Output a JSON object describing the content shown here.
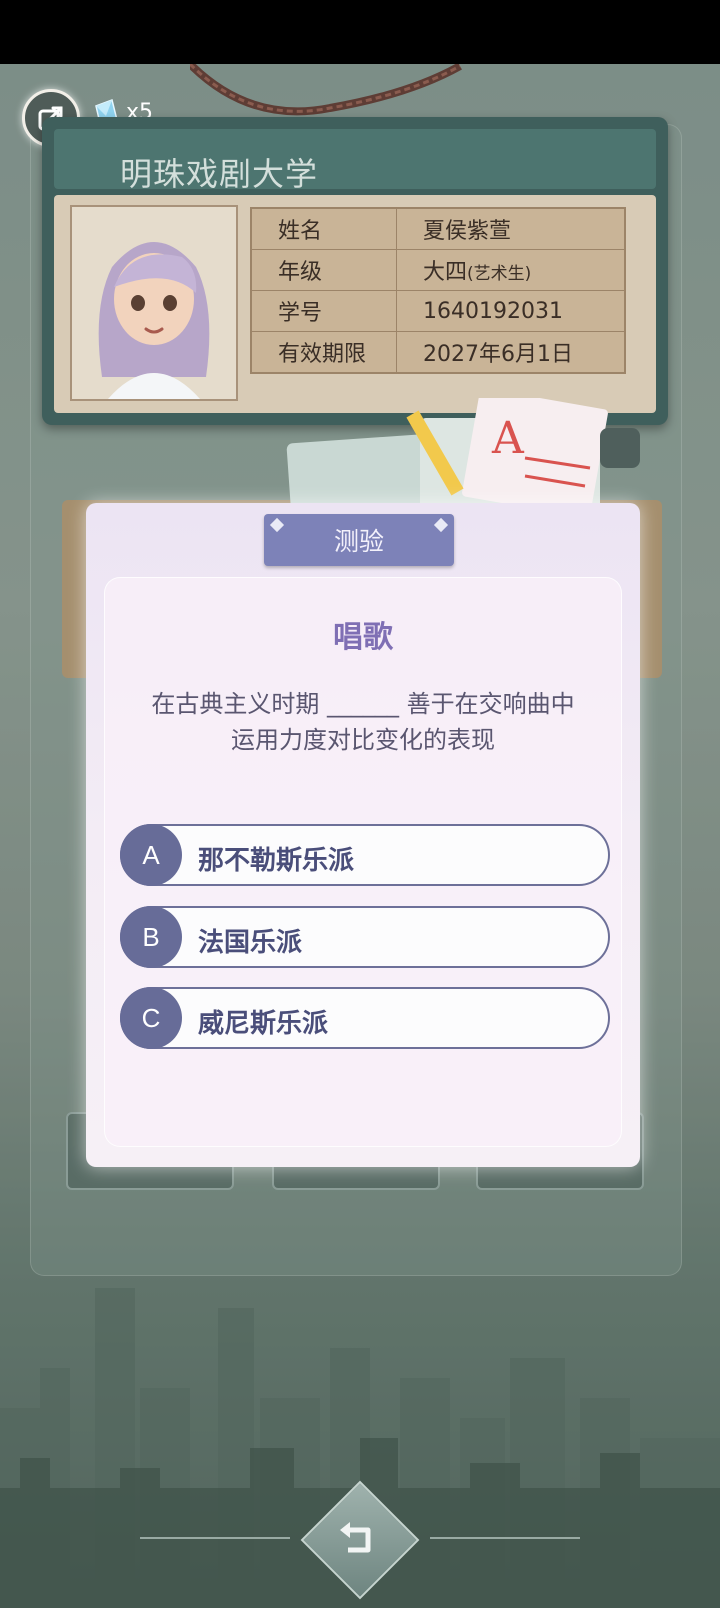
{
  "hud": {
    "gem_count": "x5",
    "exit_icon": "exit-arrow-icon",
    "gem_icon": "crystal-gem-icon"
  },
  "id_card": {
    "school_name": "明珠戏剧大学",
    "rows": [
      {
        "label": "姓名",
        "value": "夏侯紫萱"
      },
      {
        "label": "年级",
        "value": "大四",
        "value_small": "(艺术生)"
      },
      {
        "label": "学号",
        "value": "1640192031"
      },
      {
        "label": "有效期限",
        "value": "2027年6月1日"
      }
    ]
  },
  "quiz": {
    "title": "测验",
    "subject": "唱歌",
    "question": "在古典主义时期 ______ 善于在交响曲中\n运用力度对比变化的表现",
    "options": [
      {
        "letter": "A",
        "text": "那不勒斯乐派"
      },
      {
        "letter": "B",
        "text": "法国乐派"
      },
      {
        "letter": "C",
        "text": "威尼斯乐派"
      }
    ]
  },
  "colors": {
    "option_badge": "#676c98",
    "title_plate": "#7d82b8",
    "subject_text": "#7f6fb4"
  }
}
